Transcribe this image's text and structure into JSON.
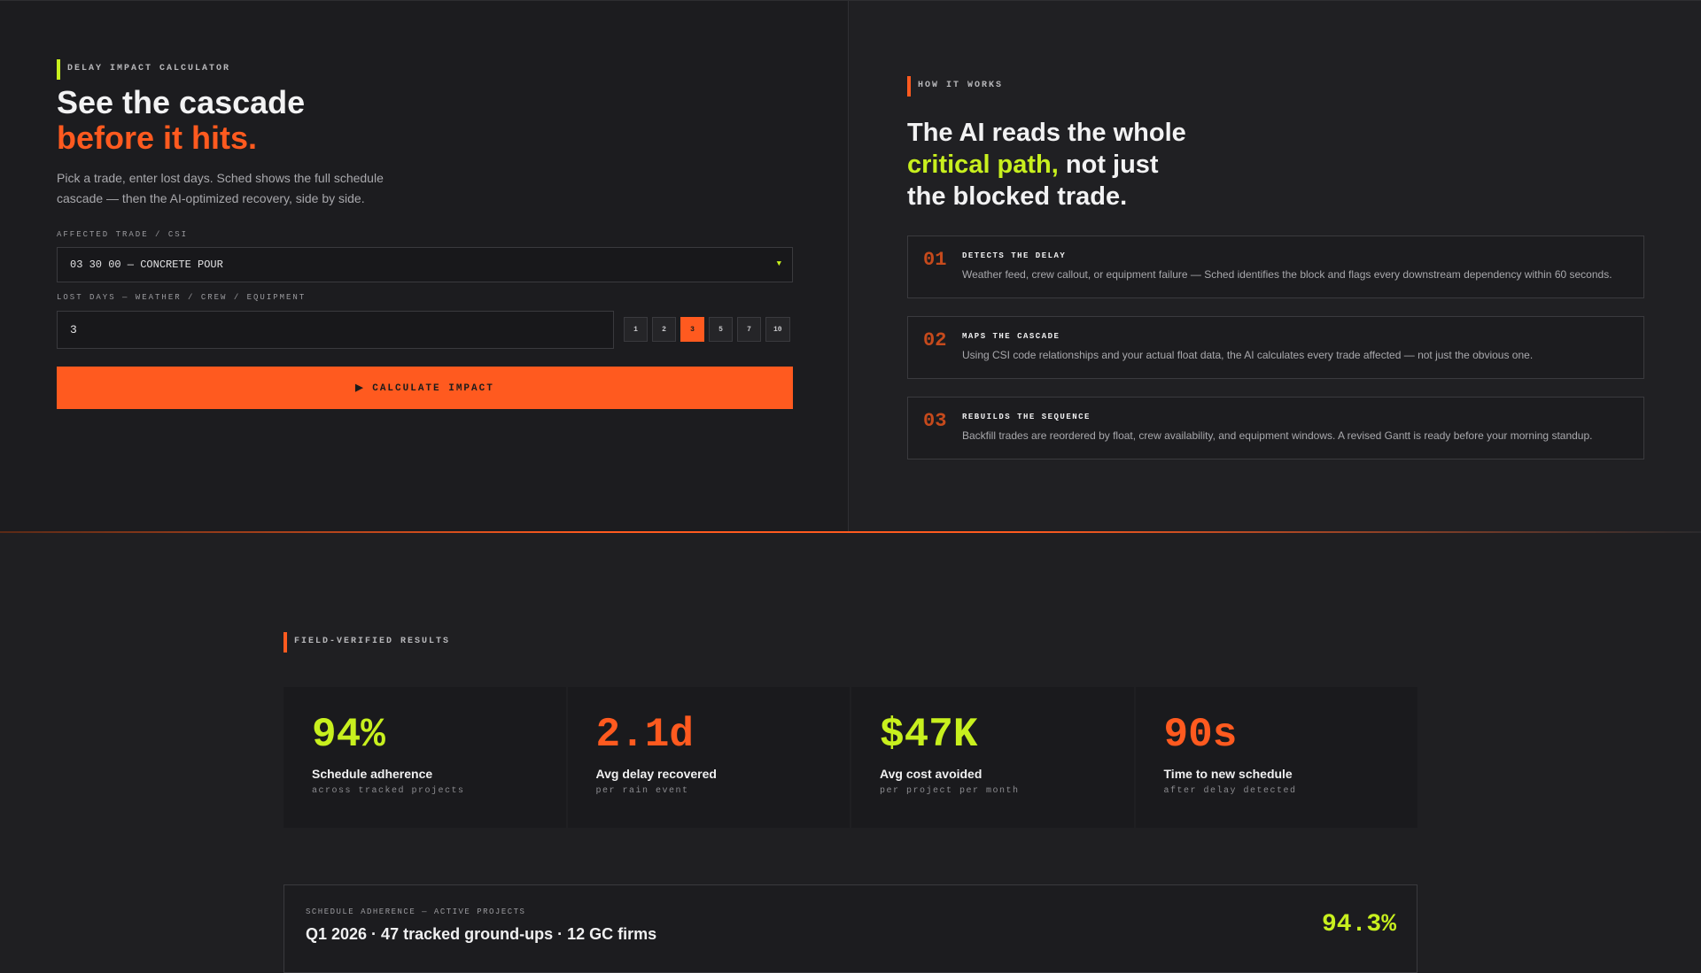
{
  "calculator": {
    "eyebrow": "DELAY IMPACT CALCULATOR",
    "title_line1": "See the cascade",
    "title_line2": "before it hits.",
    "description": "Pick a trade, enter lost days. Sched shows the full schedule cascade — then the AI-optimized recovery, side by side.",
    "trade_label": "AFFECTED TRADE / CSI",
    "trade_value": "03 30 00 — CONCRETE POUR",
    "days_label": "LOST DAYS — WEATHER / CREW / EQUIPMENT",
    "days_value": "3",
    "day_options": [
      "1",
      "2",
      "3",
      "5",
      "7",
      "10"
    ],
    "selected_day": "3",
    "cta_label": "▶ CALCULATE IMPACT"
  },
  "how_it_works": {
    "eyebrow": "HOW IT WORKS",
    "title_line1": "The AI reads the whole",
    "title_highlight": "critical path,",
    "title_line2_rest": " not just",
    "title_line3": "the blocked trade.",
    "steps": [
      {
        "num": "01",
        "title": "DETECTS THE DELAY",
        "desc": "Weather feed, crew callout, or equipment failure — Sched identifies the block and flags every downstream dependency within 60 seconds."
      },
      {
        "num": "02",
        "title": "MAPS THE CASCADE",
        "desc": "Using CSI code relationships and your actual float data, the AI calculates every trade affected — not just the obvious one."
      },
      {
        "num": "03",
        "title": "REBUILDS THE SEQUENCE",
        "desc": "Backfill trades are reordered by float, crew availability, and equipment windows. A revised Gantt is ready before your morning standup."
      }
    ]
  },
  "results": {
    "eyebrow": "FIELD-VERIFIED RESULTS",
    "stats": [
      {
        "value": "94%",
        "label": "Schedule adherence",
        "sub": "across tracked projects",
        "color": "#c8f01e"
      },
      {
        "value": "2.1d",
        "label": "Avg delay recovered",
        "sub": "per rain event",
        "color": "#ff5a1f"
      },
      {
        "value": "$47K",
        "label": "Avg cost avoided",
        "sub": "per project per month",
        "color": "#c8f01e"
      },
      {
        "value": "90s",
        "label": "Time to new schedule",
        "sub": "after delay detected",
        "color": "#ff5a1f"
      }
    ]
  },
  "adherence_card": {
    "eyebrow": "SCHEDULE ADHERENCE — ACTIVE PROJECTS",
    "title": "Q1 2026 · 47 tracked ground-ups · 12 GC firms",
    "percent": "94.3%"
  },
  "colors": {
    "accent_orange": "#ff5a1f",
    "accent_lime": "#c8f01e",
    "background": "#1f1f22"
  }
}
